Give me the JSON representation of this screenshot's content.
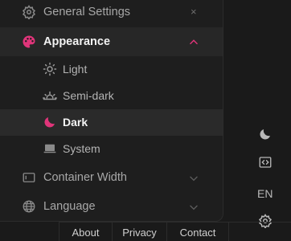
{
  "menu": {
    "general_settings": "General Settings",
    "close_symbol": "×",
    "appearance": "Appearance",
    "themes": [
      {
        "label": "Light",
        "icon": "sun-icon"
      },
      {
        "label": "Semi-dark",
        "icon": "sunset-icon"
      },
      {
        "label": "Dark",
        "icon": "moon-icon",
        "selected": true
      },
      {
        "label": "System",
        "icon": "laptop-icon"
      }
    ],
    "container_width": "Container Width",
    "language": "Language"
  },
  "sidebar": {
    "language_code": "EN",
    "icons": [
      "moon-icon",
      "code-icon",
      "gear-icon"
    ]
  },
  "footer": {
    "links": [
      "About",
      "Privacy",
      "Contact"
    ]
  },
  "colors": {
    "accent": "#e0357a",
    "background": "#1a1a1a",
    "panel": "#1e1e1e",
    "selected_row": "#2a2a2a"
  }
}
